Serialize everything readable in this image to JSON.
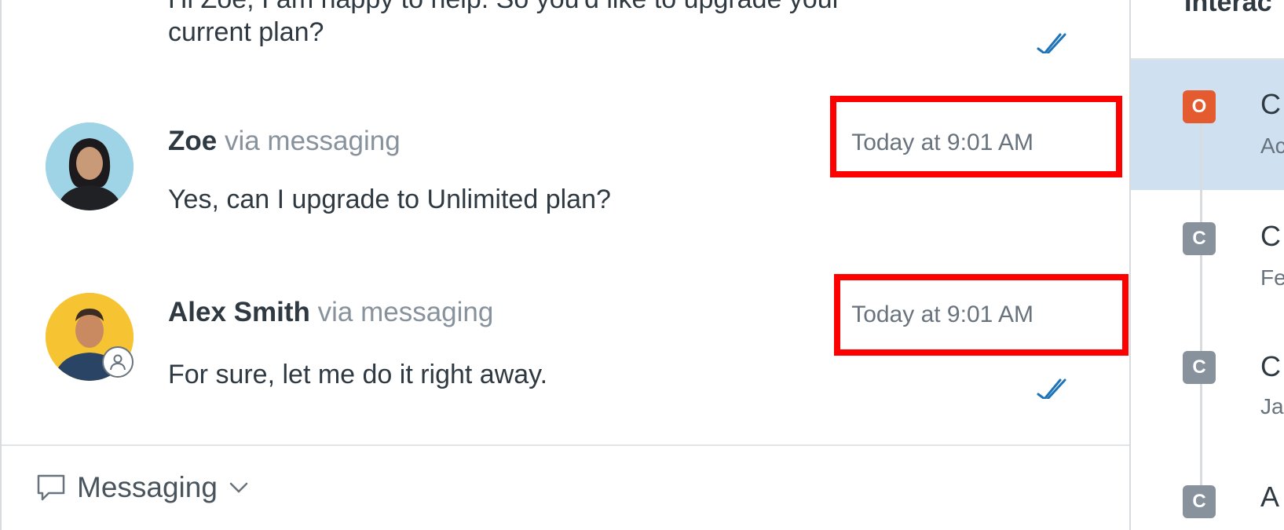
{
  "conversation": {
    "previous_message": {
      "line1": "Hi Zoe, I am happy to help. So you'd like to upgrade your",
      "line2": "current plan?"
    },
    "messages": [
      {
        "author": "Zoe",
        "via": "via messaging",
        "timestamp": "Today at 9:01 AM",
        "text": "Yes, can I upgrade to Unlimited plan?"
      },
      {
        "author": "Alex Smith",
        "via": "via messaging",
        "timestamp": "Today at 9:01 AM",
        "text": "For sure, let me do it right away."
      }
    ]
  },
  "composer": {
    "channel_label": "Messaging"
  },
  "sidebar": {
    "title": "Interac",
    "items": [
      {
        "badge": "O",
        "title": "C",
        "subtitle": "Ac",
        "status_color": "#e35b2f",
        "active": true
      },
      {
        "badge": "C",
        "title": "C",
        "subtitle": "Fe",
        "status_color": "#87929d"
      },
      {
        "badge": "C",
        "title": "C",
        "subtitle": "Ja",
        "status_color": "#87929d"
      },
      {
        "badge": "C",
        "title": "A",
        "subtitle": "",
        "status_color": "#87929d"
      }
    ]
  },
  "colors": {
    "highlight": "#ff0000",
    "active_row": "#cfe1f1",
    "read_check": "#1f73b7"
  }
}
